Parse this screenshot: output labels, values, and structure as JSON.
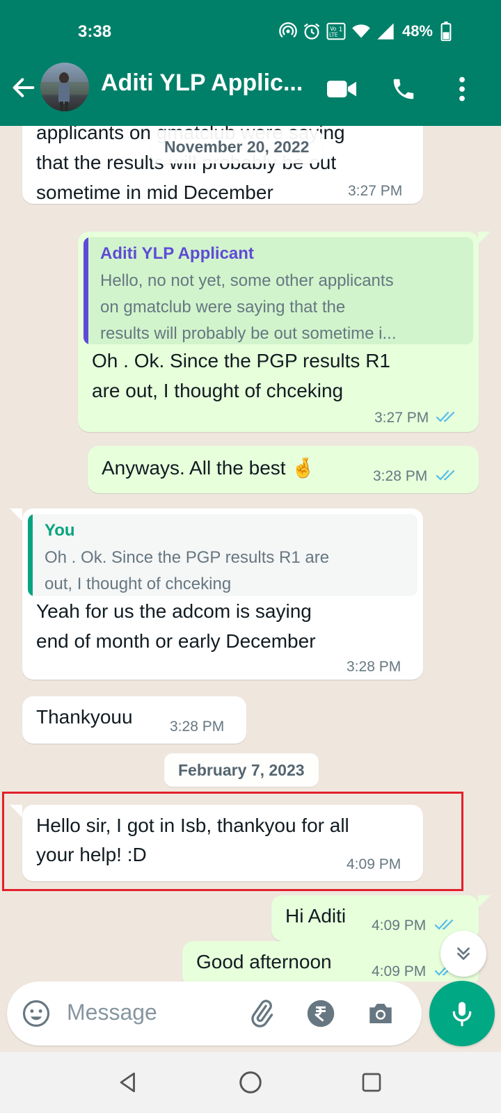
{
  "status_bar": {
    "time": "3:38",
    "battery": "48%",
    "icons": [
      "hotspot-icon",
      "alarm-icon",
      "volte-icon",
      "wifi-icon",
      "signal-icon",
      "battery-icon"
    ]
  },
  "header": {
    "contact_name": "Aditi YLP Applic...",
    "icons": [
      "back-arrow-icon",
      "video-call-icon",
      "phone-call-icon",
      "more-options-icon"
    ]
  },
  "colors": {
    "header_bg": "#008069",
    "outgoing_bubble": "#e7ffdb",
    "incoming_bubble": "#ffffff",
    "chat_bg": "#efe7de",
    "accent_green": "#00a884",
    "read_tick": "#53bdeb",
    "quote_you": "#06a47f",
    "quote_contact": "#5f4bd5",
    "highlight": "#e2202b"
  },
  "date_chips": [
    "November 20, 2022",
    "February 7, 2023"
  ],
  "messages": [
    {
      "direction": "in",
      "lines": [
        "applicants on gmatclub were saying",
        "that the results will probably be out",
        "sometime in mid December"
      ],
      "time": "3:27 PM"
    },
    {
      "direction": "out",
      "quote": {
        "name": "Aditi YLP Applicant",
        "lines": [
          "Hello, no not yet, some other applicants",
          "on gmatclub were saying that the",
          "results will probably be out sometime i..."
        ]
      },
      "lines": [
        "Oh . Ok. Since the PGP results R1",
        "are out, I thought of chceking"
      ],
      "time": "3:27 PM",
      "status": "read"
    },
    {
      "direction": "out",
      "lines": [
        "Anyways. All the best 🤞"
      ],
      "time": "3:28 PM",
      "status": "read"
    },
    {
      "direction": "in",
      "quote": {
        "name": "You",
        "lines": [
          "Oh . Ok. Since the PGP results R1 are",
          "out, I thought of chceking"
        ]
      },
      "lines": [
        "Yeah for us the adcom is saying",
        "end of month or early December"
      ],
      "time": "3:28 PM"
    },
    {
      "direction": "in",
      "lines": [
        "Thankyouu"
      ],
      "time": "3:28 PM"
    },
    {
      "direction": "in",
      "lines": [
        "Hello sir, I got in Isb, thankyou for all",
        "your help! :D"
      ],
      "time": "4:09 PM",
      "highlighted": true
    },
    {
      "direction": "out",
      "lines": [
        "Hi Aditi"
      ],
      "time": "4:09 PM",
      "status": "read"
    },
    {
      "direction": "out",
      "lines": [
        "Good afternoon"
      ],
      "time": "4:09 PM",
      "status": "read"
    }
  ],
  "input": {
    "placeholder": "Message",
    "icons": [
      "emoji-icon",
      "attach-icon",
      "rupee-payment-icon",
      "camera-icon",
      "mic-icon"
    ]
  },
  "nav": {
    "icons": [
      "nav-back-icon",
      "nav-home-icon",
      "nav-recents-icon"
    ]
  }
}
